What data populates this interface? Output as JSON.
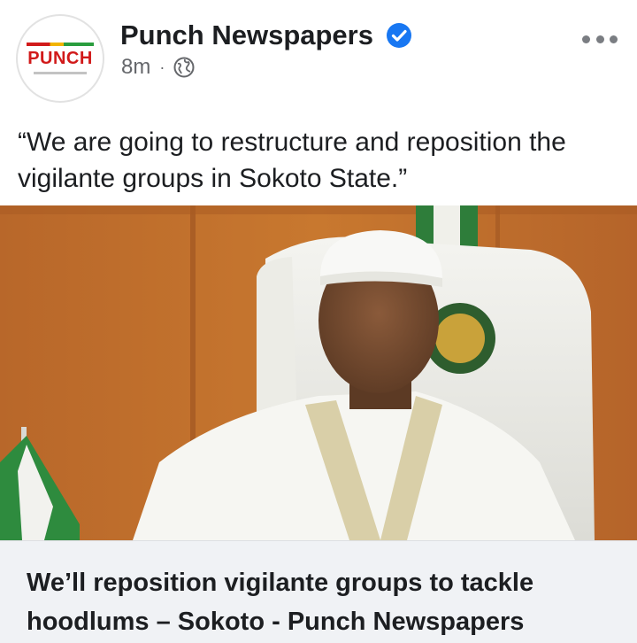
{
  "post": {
    "page_name": "Punch Newspapers",
    "avatar_text": "PUNCH",
    "time_ago": "8m",
    "separator": "·",
    "privacy_icon": "globe-icon",
    "verified_icon": "verified-badge-icon",
    "more_icon": "more-options-icon",
    "text": "“We are going to restructure and reposition the vigilante groups in Sokoto State.”",
    "link_title": "We’ll reposition vigilante groups to tackle hoodlums – Sokoto - Punch Newspapers"
  },
  "colors": {
    "verified_blue": "#1877f2",
    "brand_red": "#d11a1a",
    "meta_gray": "#65676b",
    "link_card_bg": "#f0f2f5"
  }
}
